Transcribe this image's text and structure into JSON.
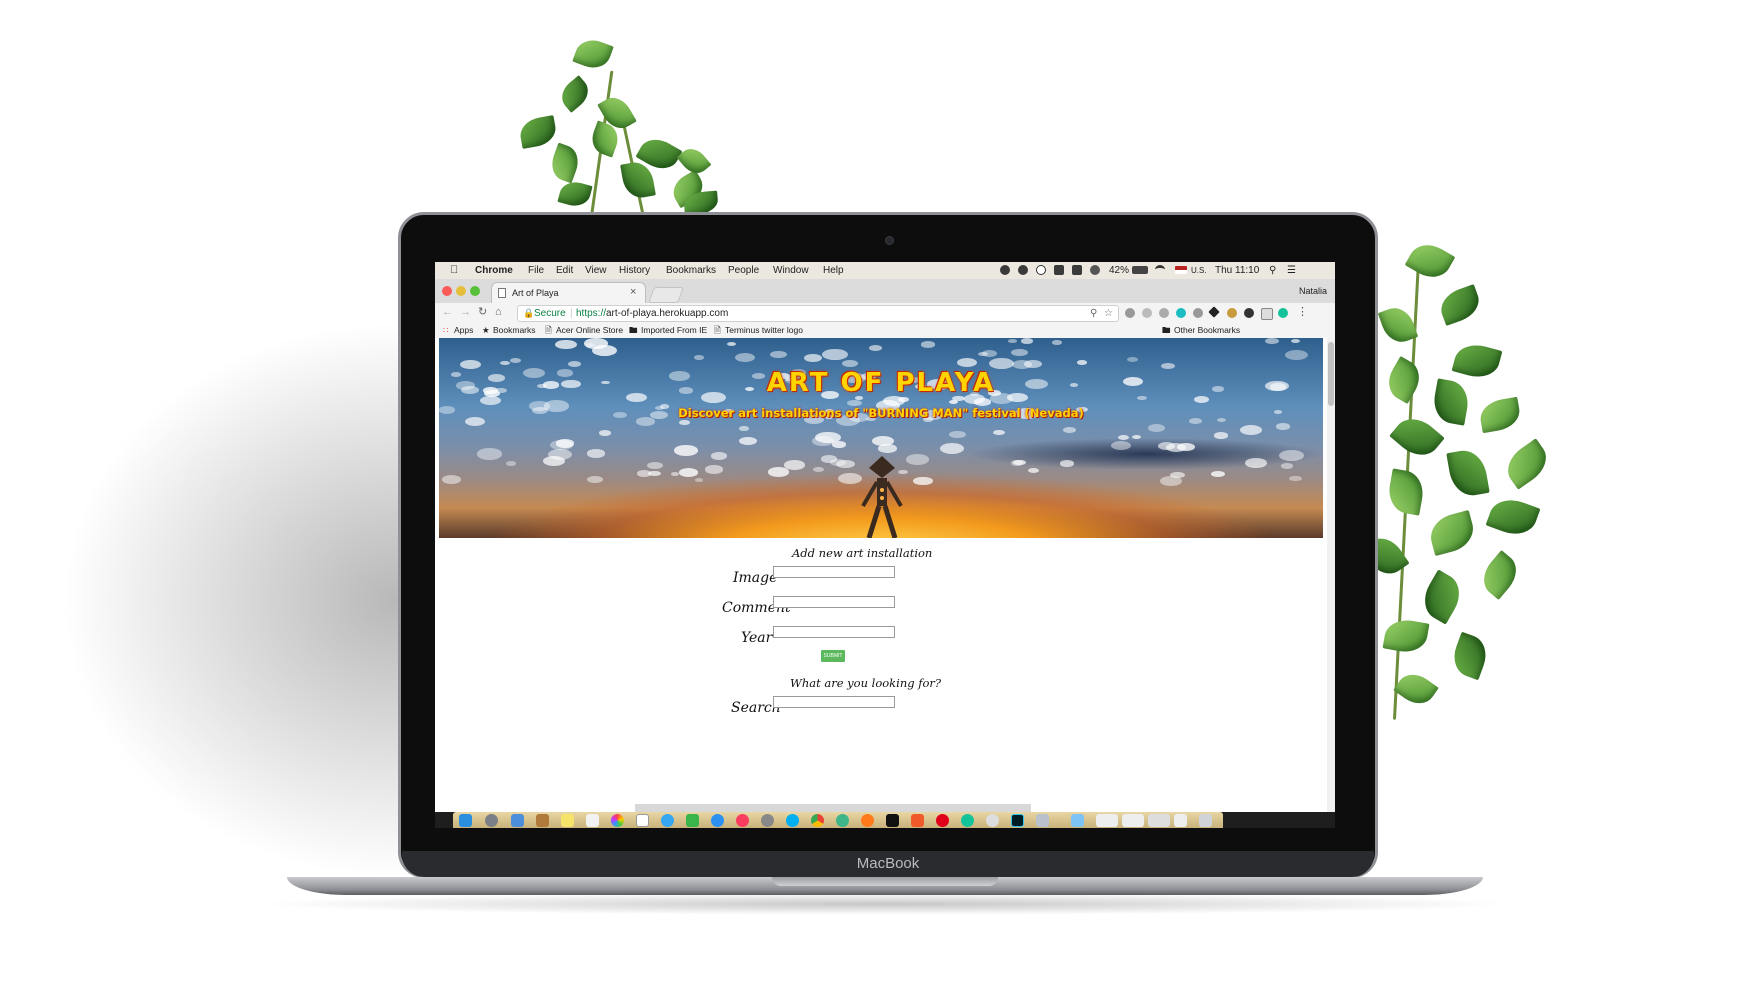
{
  "menubar": {
    "app_name": "Chrome",
    "menus": [
      "File",
      "Edit",
      "View",
      "History",
      "Bookmarks",
      "People",
      "Window",
      "Help"
    ],
    "battery": "42%",
    "input_source": "U.S.",
    "clock": "Thu 11:10"
  },
  "browser": {
    "tab_title": "Art of Playa",
    "tab_close": "×",
    "profile_name": "Natalia",
    "secure_label": "Secure",
    "url_scheme": "https://",
    "url_host": "art-of-playa.herokuapp.com"
  },
  "bookmarks": [
    {
      "label": "Apps",
      "icon": "apps-grid-icon"
    },
    {
      "label": "Bookmarks",
      "icon": "star-icon"
    },
    {
      "label": "Acer Online Store",
      "icon": "page-icon"
    },
    {
      "label": "Imported From IE",
      "icon": "folder-icon"
    },
    {
      "label": "Terminus twitter logo",
      "icon": "page-icon"
    }
  ],
  "other_bookmarks": "Other Bookmarks",
  "hero": {
    "title": "ART OF PLAYA",
    "subtitle": "Discover art installations of \"BURNING MAN\" festival (Nevada)"
  },
  "form": {
    "heading": "Add new art installation",
    "image_label": "Image",
    "comment_label": "Comment",
    "year_label": "Year",
    "image_value": "",
    "comment_value": "",
    "year_value": "",
    "submit_label": "SUBMIT"
  },
  "search": {
    "heading": "What are you looking for?",
    "label": "Search",
    "value": ""
  },
  "device": {
    "label": "MacBook"
  },
  "colors": {
    "hero_title": "#ffd400",
    "submit_button": "#5cb85c",
    "secure_green": "#0b8043"
  }
}
